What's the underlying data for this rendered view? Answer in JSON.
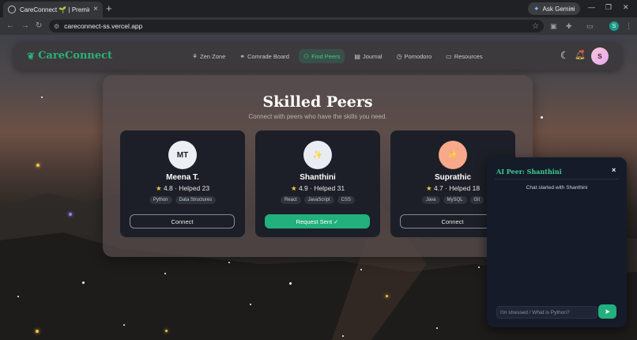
{
  "browser": {
    "tab_title": "CareConnect 🌱 | Premium Ca",
    "url": "careconnect-ss.vercel.app",
    "gemini_label": "Ask Gemini",
    "profile_initial": "S"
  },
  "nav": {
    "brand": "CareConnect",
    "links": [
      {
        "label": "Zen Zone",
        "icon": "spa-icon"
      },
      {
        "label": "Comrade Board",
        "icon": "handshake-icon"
      },
      {
        "label": "Find Peers",
        "icon": "people-icon"
      },
      {
        "label": "Journal",
        "icon": "book-icon"
      },
      {
        "label": "Pomodoro",
        "icon": "clock-icon"
      },
      {
        "label": "Resources",
        "icon": "folder-icon"
      }
    ],
    "active_link": "Find Peers",
    "avatar_initial": "S"
  },
  "main": {
    "title": "Skilled Peers",
    "subtitle": "Connect with peers who have the skills you need.",
    "peers": [
      {
        "avatar": "MT",
        "name": "Meena T.",
        "stats": "4.8 · Helped 23",
        "skills": [
          "Python",
          "Data Structures"
        ],
        "button": "Connect"
      },
      {
        "avatar": "✨",
        "name": "Shanthini",
        "stats": "4.9 · Helped 31",
        "skills": [
          "React",
          "JavaScript",
          "CSS"
        ],
        "button": "Request Sent ✓"
      },
      {
        "avatar": "✨",
        "name": "Suprathic",
        "stats": "4.7 · Helped 18",
        "skills": [
          "Java",
          "MySQL",
          "Git"
        ],
        "button": "Connect"
      }
    ]
  },
  "chat": {
    "title": "AI Peer: Shanthini",
    "close": "×",
    "system_message": "Chat started with Shanthini",
    "input_placeholder": "I'm stressed / What is Python?"
  },
  "colors": {
    "accent": "#22b07d",
    "brand": "#2bb07a",
    "star": "#f5c542"
  }
}
